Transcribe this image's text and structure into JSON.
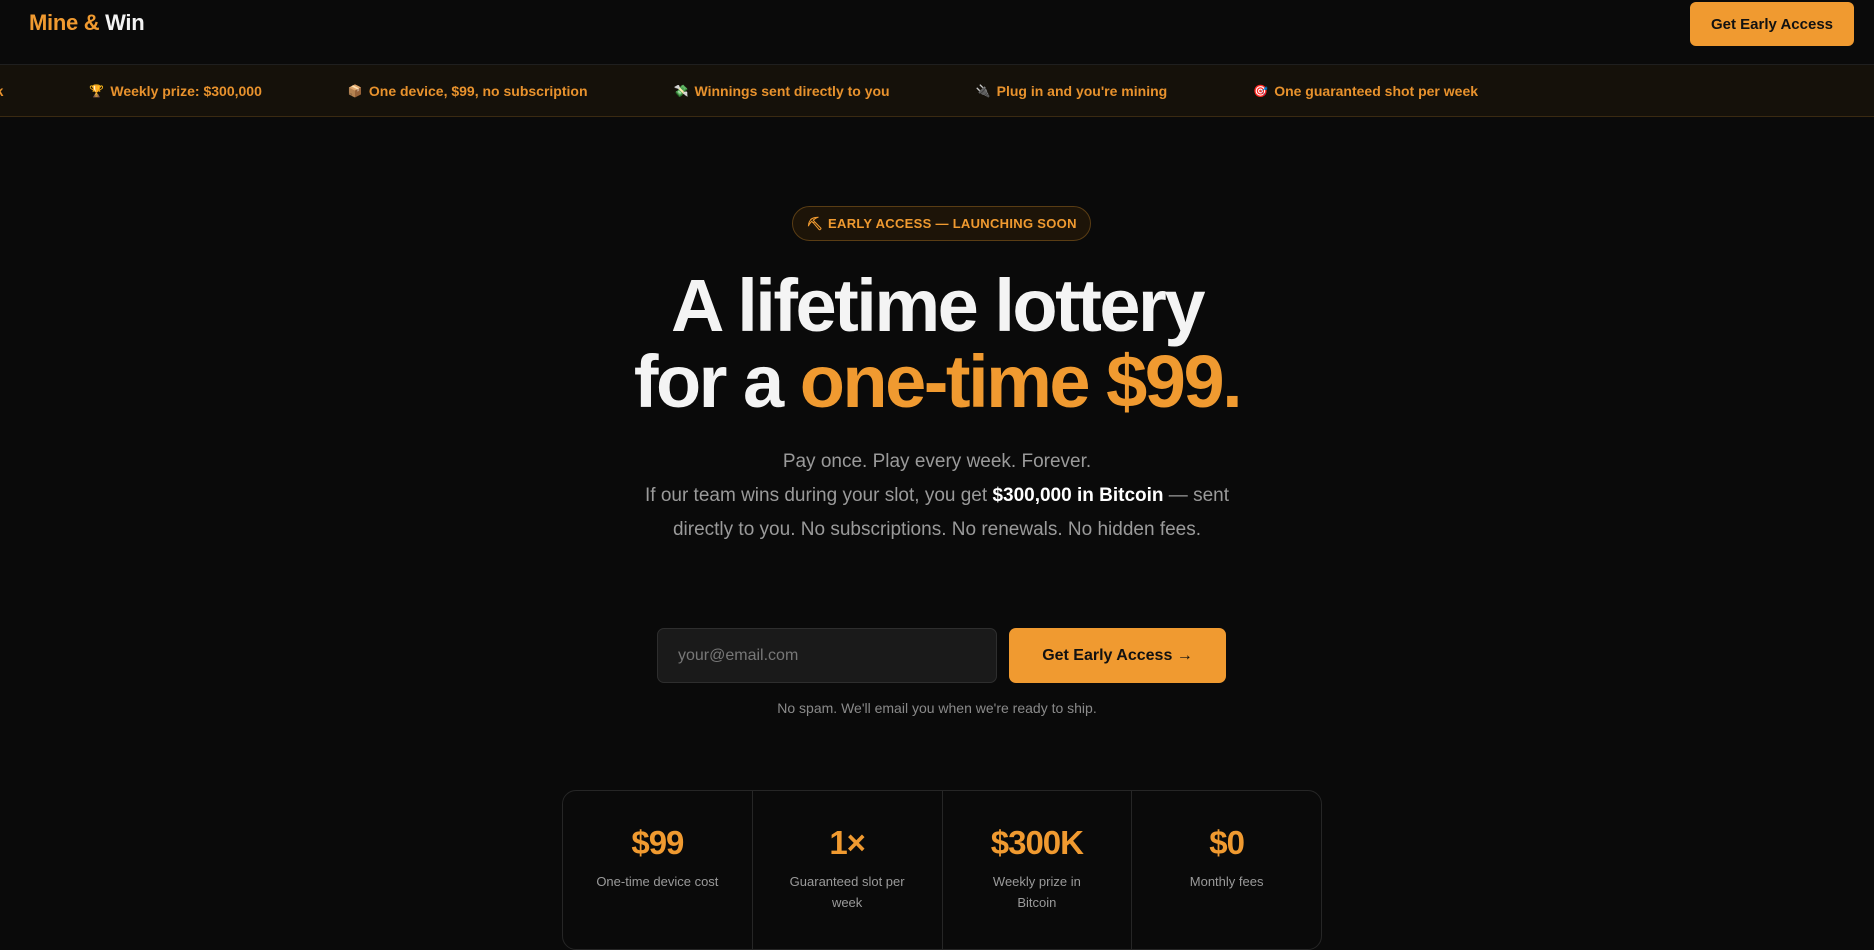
{
  "header": {
    "logo_part1": "Mine &",
    "logo_part2": "Win",
    "cta_label": "Get Early Access"
  },
  "ticker": {
    "items": [
      {
        "icon": "",
        "text": "eek"
      },
      {
        "icon": "trophy-icon",
        "glyph": "🏆",
        "text": "Weekly prize: $300,000"
      },
      {
        "icon": "package-icon",
        "glyph": "📦",
        "text": "One device, $99, no subscription"
      },
      {
        "icon": "money-with-wings-icon",
        "glyph": "💸",
        "text": "Winnings sent directly to you"
      },
      {
        "icon": "plug-icon",
        "glyph": "🔌",
        "text": "Plug in and you're mining"
      },
      {
        "icon": "target-icon",
        "glyph": "🎯",
        "text": "One guaranteed shot per week"
      }
    ]
  },
  "hero": {
    "badge_icon": "pickaxe-icon",
    "badge_glyph": "⛏",
    "badge_text": "EARLY ACCESS — LAUNCHING SOON",
    "headline_line1": "A lifetime lottery",
    "headline_line2_prefix": "for a ",
    "headline_line2_accent": "one-time $99.",
    "subcopy_line1": "Pay once. Play every week. Forever.",
    "subcopy_pre": "If our team wins during your slot, you get ",
    "subcopy_strong": "$300,000 in Bitcoin",
    "subcopy_post": " — sent directly to you. No subscriptions. No renewals. No hidden fees.",
    "email_placeholder": "your@email.com",
    "email_value": "",
    "cta_label": "Get Early Access →",
    "disclaimer": "No spam. We'll email you when we're ready to ship."
  },
  "stats": [
    {
      "value": "$99",
      "label": "One-time device cost"
    },
    {
      "value": "1×",
      "label": "Guaranteed slot per week"
    },
    {
      "value": "$300K",
      "label": "Weekly prize in Bitcoin"
    },
    {
      "value": "$0",
      "label": "Monthly fees"
    }
  ],
  "colors": {
    "background": "#0a0a0a",
    "accent": "#f09a30",
    "ticker_background": "#15110a",
    "muted_text": "#9a9a9a"
  }
}
